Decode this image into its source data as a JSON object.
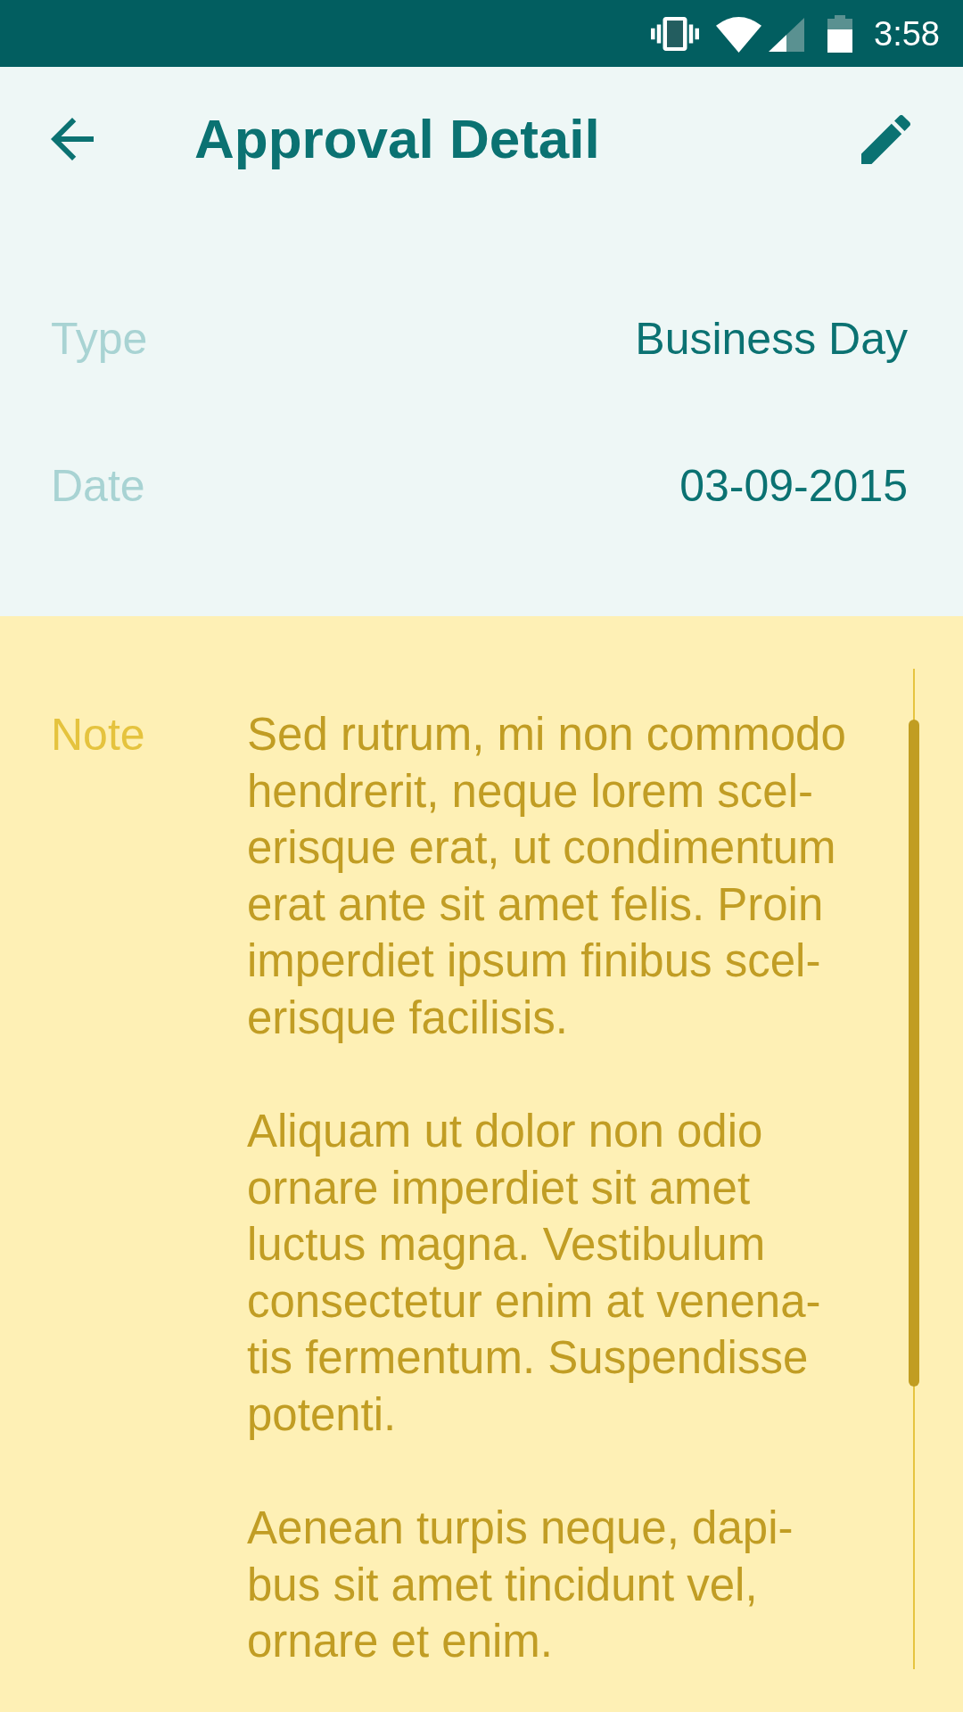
{
  "status_bar": {
    "time": "3:58"
  },
  "app_bar": {
    "title": "Approval Detail"
  },
  "fields": [
    {
      "label": "Type",
      "value": "Business Day"
    },
    {
      "label": "Date",
      "value": "03-09-2015"
    }
  ],
  "note": {
    "label": "Note",
    "paragraphs": [
      [
        "Sed rutrum, mi non commodo",
        "hendrerit, neque lorem scel-",
        "erisque erat, ut condimentum",
        "erat ante sit amet felis. Proin",
        "imperdiet ipsum finibus scel-",
        "erisque facilisis."
      ],
      [
        "Aliquam ut dolor non odio",
        "ornare imperdiet sit amet",
        "luctus magna. Vestibulum",
        "consectetur enim at venena-",
        "tis fermentum. Suspendisse",
        "potenti."
      ],
      [
        "Aenean turpis neque, dapi-",
        "bus sit amet tincidunt vel,",
        "ornare et enim."
      ]
    ]
  }
}
